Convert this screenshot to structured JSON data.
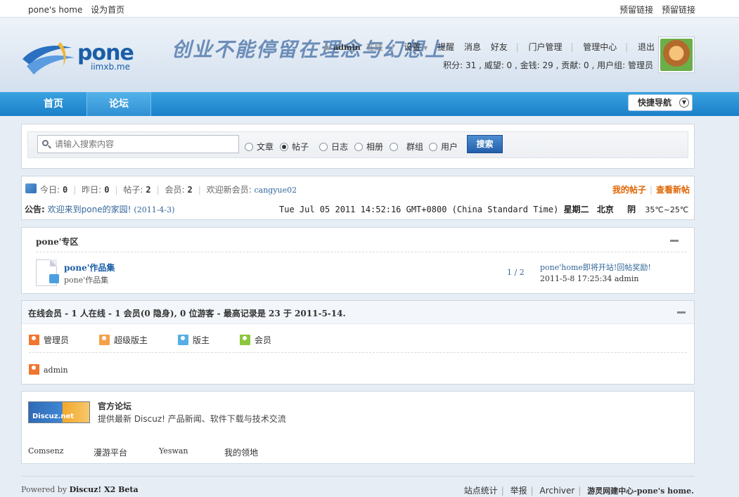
{
  "topbar": {
    "home": "pone's home",
    "set_home": "设为首页",
    "reserved_1": "预留链接",
    "reserved_2": "预留链接"
  },
  "header": {
    "logo_text": "pone",
    "logo_sub": "iimxb.me",
    "slogan": "创业不能停留在理念与幻想上",
    "username": "admin",
    "online_status": "在线",
    "nav_items": [
      "设置",
      "提醒",
      "消息",
      "好友",
      "门户管理",
      "管理中心",
      "退出"
    ],
    "stats_text": "积分: 31 , 威望: 0 , 金钱: 29 , 贡献: 0 , 用户组: 管理员"
  },
  "nav": {
    "items": [
      "首页",
      "论坛"
    ],
    "quick_nav": "快捷导航"
  },
  "search": {
    "placeholder": "请输入搜索内容",
    "options": [
      "文章",
      "帖子",
      "日志",
      "相册",
      "群组",
      "用户"
    ],
    "selected": "帖子",
    "button": "搜索"
  },
  "stats": {
    "today_label": "今日:",
    "today": "0",
    "yesterday_label": "昨日:",
    "yesterday": "0",
    "posts_label": "帖子:",
    "posts": "2",
    "members_label": "会员:",
    "members": "2",
    "newmember_label": "欢迎新会员:",
    "newmember": "cangyue02",
    "my_posts": "我的帖子",
    "new_posts": "查看新帖"
  },
  "notice": {
    "label": "公告:",
    "text": "欢迎来到pone的家园!",
    "date": "(2011-4-3)"
  },
  "clock": {
    "datetime": "Tue Jul 05 2011 14:52:16 GMT+0800 (China Standard Time)",
    "weekday": "星期二",
    "city": "北京",
    "weather": "阴",
    "temp": "35℃~25℃"
  },
  "forum_section": {
    "title": "pone'专区",
    "forum_name": "pone'作品集",
    "forum_desc": "pone'作品集",
    "count": "1 / 2",
    "last_post_title": "pone'home即将开站!回帖奖励!",
    "last_post_meta": "2011-5-8 17:25:34 admin"
  },
  "online": {
    "title": "在线会员 - 1 人在线 - 1 会员(0 隐身), 0 位游客 - 最高记录是 23 于 2011-5-14.",
    "roles": [
      "管理员",
      "超级版主",
      "版主",
      "会员"
    ],
    "user": "admin"
  },
  "links": {
    "discuz_logo": "Discuz.net",
    "official_title": "官方论坛",
    "official_desc": "提供最新 Discuz! 产品新闻、软件下载与技术交流",
    "friends": [
      "Comsenz",
      "漫游平台",
      "Yeswan",
      "我的领地"
    ]
  },
  "footer": {
    "powered": "Powered by",
    "product": "Discuz! X2 Beta",
    "links": [
      "站点统计",
      "举报",
      "Archiver"
    ],
    "site_name": "游灵网建中心-pone's home."
  },
  "colors": {
    "nav_blue": "#1a7fc9",
    "link_blue": "#336699",
    "accent_orange": "#e06400",
    "role_admin": "#f07630",
    "role_supermod": "#f5a14a",
    "role_mod": "#55aee6",
    "role_member": "#8cc63e"
  }
}
